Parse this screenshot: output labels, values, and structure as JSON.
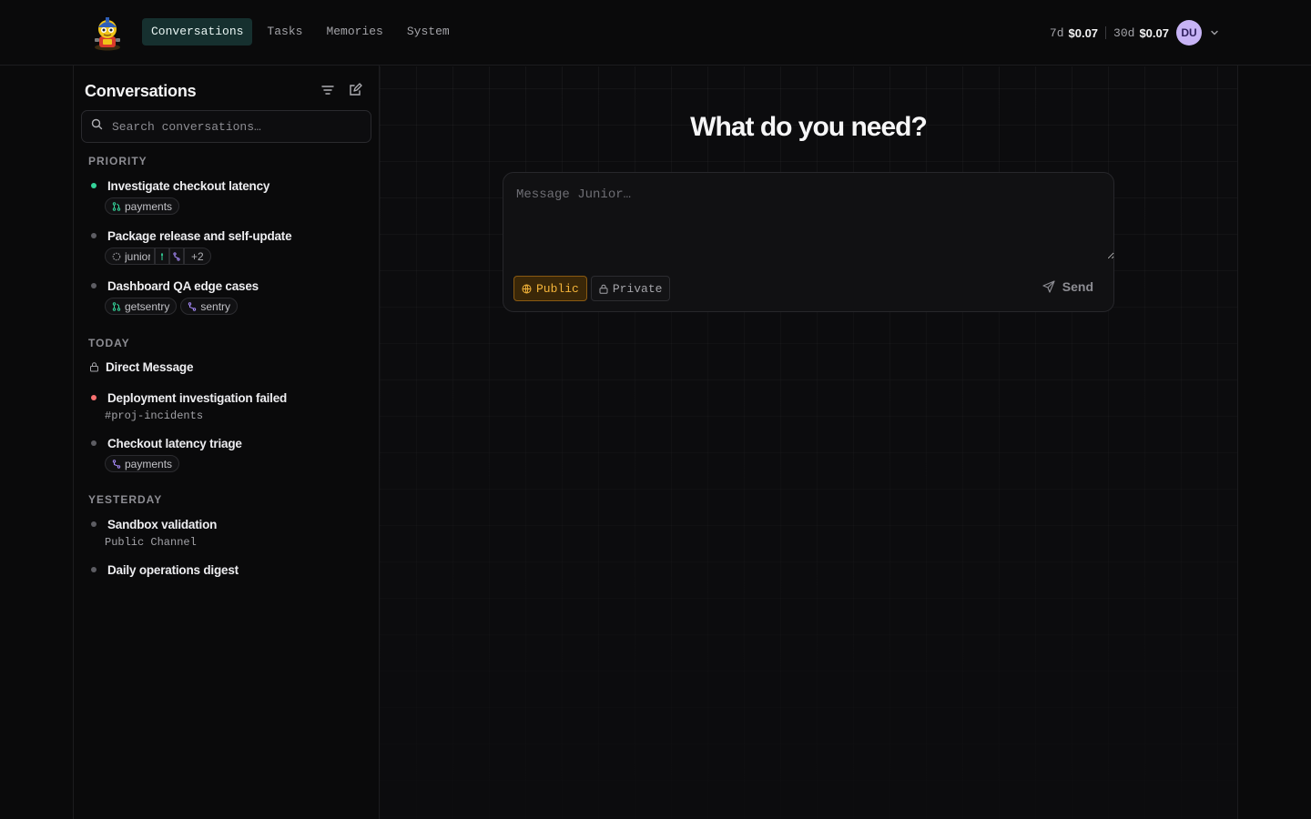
{
  "nav": {
    "tabs": [
      {
        "label": "Conversations",
        "active": true
      },
      {
        "label": "Tasks",
        "active": false
      },
      {
        "label": "Memories",
        "active": false
      },
      {
        "label": "System",
        "active": false
      }
    ]
  },
  "costs": {
    "week": {
      "period": "7d",
      "amount": "$0.07"
    },
    "month": {
      "period": "30d",
      "amount": "$0.07"
    }
  },
  "user": {
    "initials": "DU",
    "color": "#c7b3f5"
  },
  "sidebar": {
    "title": "Conversations",
    "search_placeholder": "Search conversations…",
    "groups": [
      {
        "label": "PRIORITY",
        "items": [
          {
            "title": "Investigate checkout latency",
            "status": "green",
            "chips": [
              "payments"
            ]
          },
          {
            "title": "Package release and self-update",
            "status": "gray",
            "chips": [
              "junior",
              "+2"
            ]
          },
          {
            "title": "Dashboard QA edge cases",
            "status": "gray",
            "chips": [
              "getsentry",
              "sentry"
            ]
          }
        ]
      },
      {
        "label": "TODAY",
        "items": [
          {
            "title": "Direct Message",
            "status": "lock"
          },
          {
            "title": "Deployment investigation failed",
            "status": "red",
            "subtitle": "#proj-incidents"
          },
          {
            "title": "Checkout latency triage",
            "status": "gray",
            "chips": [
              "payments"
            ]
          }
        ]
      },
      {
        "label": "YESTERDAY",
        "items": [
          {
            "title": "Sandbox validation",
            "status": "gray",
            "subtitle": "Public Channel"
          },
          {
            "title": "Daily operations digest",
            "status": "gray"
          }
        ]
      }
    ]
  },
  "main": {
    "headline": "What do you need?",
    "composer_placeholder": "Message Junior…",
    "visibility": {
      "public_label": "Public",
      "private_label": "Private",
      "selected": "Public"
    },
    "send_label": "Send"
  },
  "colors": {
    "accent_active_tab": "#16302f",
    "public_accent": "#f5b53a",
    "status_green": "#34d399",
    "status_red": "#f87171"
  }
}
